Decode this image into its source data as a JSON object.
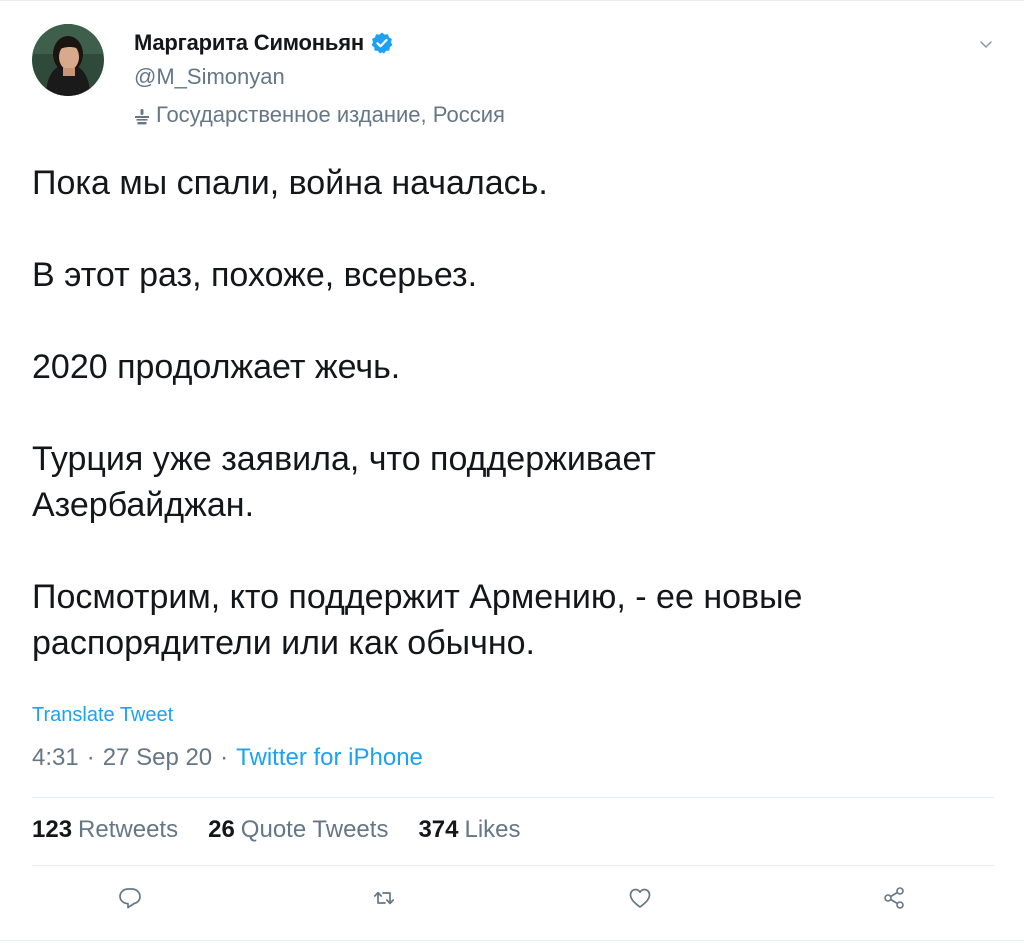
{
  "author": {
    "display_name": "Маргарита Симоньян",
    "handle": "@M_Simonyan",
    "label": "Государственное издание, Россия",
    "avatar_icon": "avatar-portrait",
    "verified_icon": "verified-badge-icon"
  },
  "tweet": {
    "paragraphs": [
      "Пока мы спали, война началась.",
      "В этот раз, похоже, всерьез.",
      "2020 продолжает жечь.",
      "Турция уже заявила, что поддерживает Азербайджан.",
      "Посмотрим, кто поддержит Армению, - ее новые распорядители или как обычно."
    ],
    "translate_label": "Translate Tweet",
    "time": "4:31",
    "date": "27 Sep 20",
    "source": "Twitter for iPhone",
    "separator": "·"
  },
  "stats": {
    "retweets_count": "123",
    "retweets_label": "Retweets",
    "quotes_count": "26",
    "quotes_label": "Quote Tweets",
    "likes_count": "374",
    "likes_label": "Likes"
  },
  "actions": {
    "reply_icon": "reply-icon",
    "retweet_icon": "retweet-icon",
    "like_icon": "heart-icon",
    "share_icon": "share-icon"
  },
  "colors": {
    "accent": "#1da1f2",
    "secondary_text": "#657786",
    "primary_text": "#14171a",
    "border": "#e6ecf0"
  }
}
